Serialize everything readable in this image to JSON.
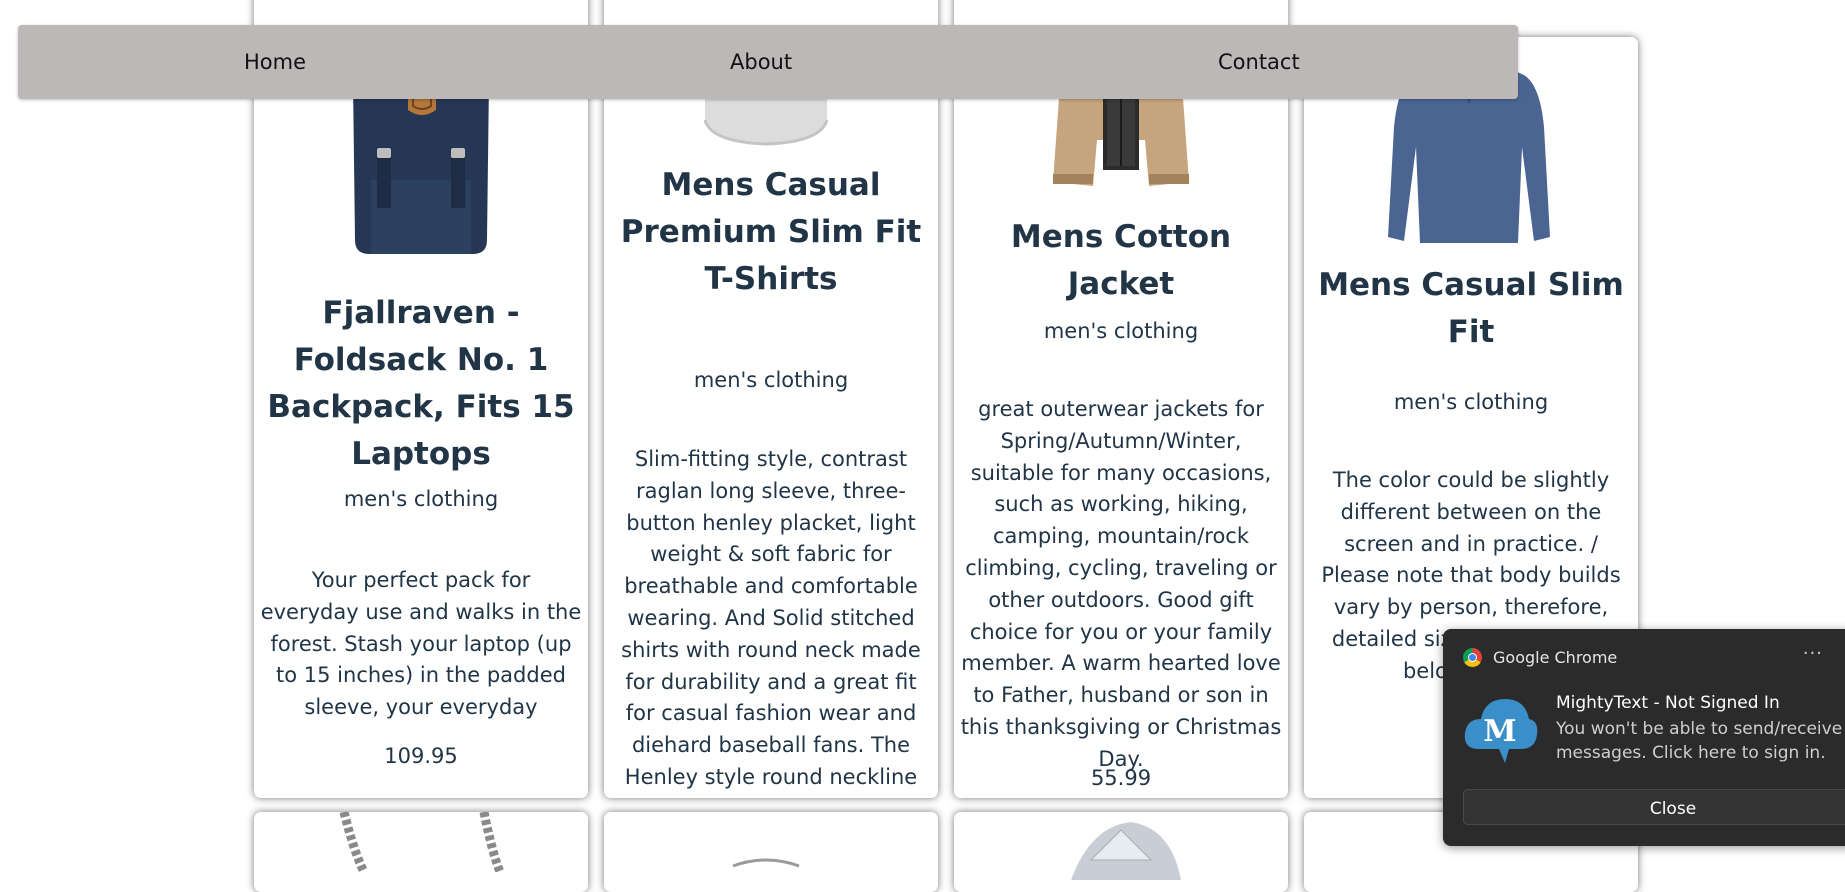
{
  "nav": {
    "home": "Home",
    "about": "About",
    "contact": "Contact"
  },
  "products": [
    {
      "title": "Fjallraven - Foldsack No. 1 Backpack, Fits 15 Laptops",
      "category": "men's clothing",
      "description": "Your perfect pack for everyday use and walks in the forest. Stash your laptop (up to 15 inches) in the padded sleeve, your everyday",
      "price": "109.95"
    },
    {
      "title": "Mens Casual Premium Slim Fit T-Shirts",
      "category": "men's clothing",
      "description": "Slim-fitting style, contrast raglan long sleeve, three-button henley placket, light weight & soft fabric for breathable and comfortable wearing. And Solid stitched shirts with round neck made for durability and a great fit for casual fashion wear and diehard baseball fans. The Henley style round neckline includes a three-button placket."
    },
    {
      "title": "Mens Cotton Jacket",
      "category": "men's clothing",
      "description": "great outerwear jackets for Spring/Autumn/Winter, suitable for many occasions, such as working, hiking, camping, mountain/rock climbing, cycling, traveling or other outdoors. Good gift choice for you or your family member. A warm hearted love to Father, husband or son in this thanksgiving or Christmas Day.",
      "price": "55.99"
    },
    {
      "title": "Mens Casual Slim Fit",
      "category": "men's clothing",
      "description": "The color could be slightly different between on the screen and in practice. / Please note that body builds vary by person, therefore, detailed size information s below on the"
    }
  ],
  "notification": {
    "app": "Google Chrome",
    "more": "···",
    "title": "MightyText - Not Signed In",
    "body": "You won't be able to send/receive messages. Click here to sign in.",
    "close": "Close",
    "icon_letter": "M"
  }
}
